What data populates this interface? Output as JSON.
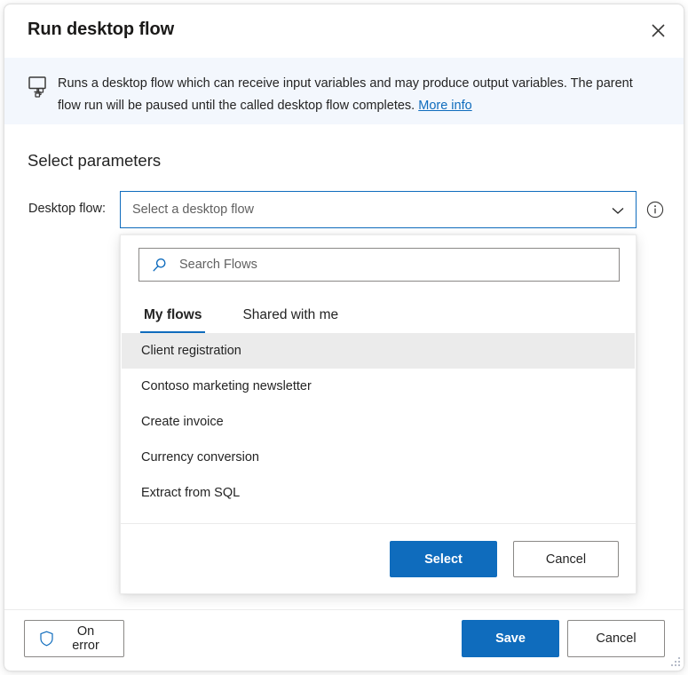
{
  "dialog": {
    "title": "Run desktop flow",
    "close_icon": "close-icon"
  },
  "info_banner": {
    "icon": "desktop-flow-icon",
    "text": "Runs a desktop flow which can receive input variables and may produce output variables. The parent flow run will be paused until the called desktop flow completes. ",
    "link_label": "More info"
  },
  "body": {
    "section_title": "Select parameters",
    "field_label": "Desktop flow:",
    "combobox": {
      "placeholder": "Select a desktop flow",
      "value": "",
      "chevron_icon": "chevron-down-icon"
    },
    "info_tooltip_icon": "info-circle-icon"
  },
  "dropdown": {
    "search": {
      "placeholder": "Search Flows",
      "value": "",
      "icon": "search-icon"
    },
    "tabs": [
      {
        "label": "My flows",
        "active": true
      },
      {
        "label": "Shared with me",
        "active": false
      }
    ],
    "flows": [
      {
        "name": "Client registration",
        "selected": true
      },
      {
        "name": "Contoso marketing newsletter",
        "selected": false
      },
      {
        "name": "Create invoice",
        "selected": false
      },
      {
        "name": "Currency conversion",
        "selected": false
      },
      {
        "name": "Extract from SQL",
        "selected": false
      }
    ],
    "actions": {
      "select_label": "Select",
      "cancel_label": "Cancel"
    }
  },
  "footer": {
    "on_error_label": "On error",
    "on_error_icon": "shield-icon",
    "save_label": "Save",
    "cancel_label": "Cancel"
  },
  "colors": {
    "accent": "#0f6cbd",
    "banner_bg": "#f3f7fd",
    "selected_row": "#ebebeb",
    "text": "#242424",
    "placeholder": "#616161"
  }
}
